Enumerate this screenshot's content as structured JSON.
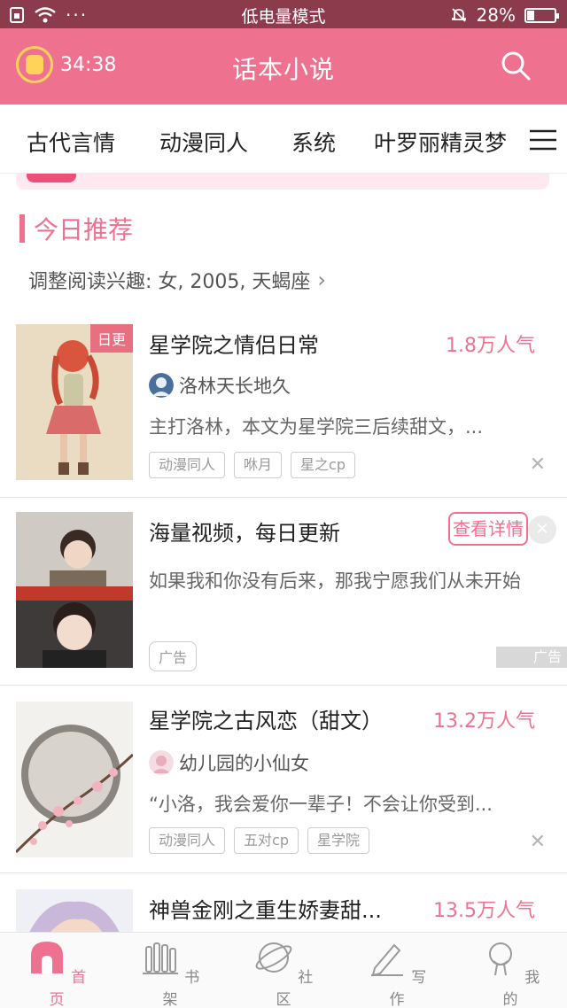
{
  "status_bar": {
    "mode": "低电量模式",
    "battery": "28%",
    "battery_level": 0.28
  },
  "header": {
    "timer": "34:38",
    "title": "话本小说"
  },
  "categories": [
    "古代言情",
    "动漫同人",
    "系统",
    "叶罗丽精灵梦"
  ],
  "section": {
    "title": "今日推荐",
    "interest": "调整阅读兴趣: 女, 2005, 天蝎座"
  },
  "books": [
    {
      "title": "星学院之情侣日常",
      "badge": "日更",
      "popularity": "1.8万人气",
      "author": "洛林天长地久",
      "description": "主打洛林，本文为星学院三后续甜文，...",
      "tags": [
        "动漫同人",
        "咻月",
        "星之cp"
      ]
    },
    {
      "title": "星学院之古风恋（甜文）",
      "popularity": "13.2万人气",
      "author": "幼儿园的小仙女",
      "description": "“小洛，我会爱你一辈子！不会让你受到...",
      "tags": [
        "动漫同人",
        "五对cp",
        "星学院"
      ]
    },
    {
      "title": "神兽金刚之重生娇妻甜...",
      "popularity": "13.5万人气"
    }
  ],
  "ad": {
    "title": "海量视频，每日更新",
    "button": "查看详情",
    "description": "如果我和你没有后来，那我宁愿我们从未开始",
    "tag": "广告",
    "badge": "广告"
  },
  "bottom_nav": [
    "首页",
    "书架",
    "社区",
    "写作",
    "我的"
  ],
  "colors": {
    "accent": "#ef7190",
    "status_bar": "#8c3b4c"
  }
}
